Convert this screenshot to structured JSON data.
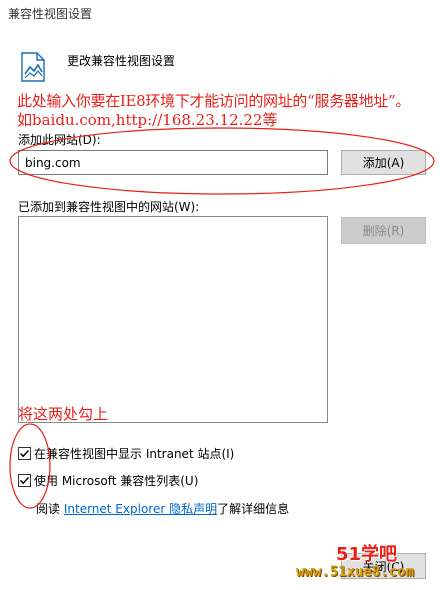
{
  "window": {
    "title": "兼容性视图设置"
  },
  "header": {
    "title": "更改兼容性视图设置",
    "icon": "compatibility-view-icon"
  },
  "annotations": {
    "line1": "此处输入你要在IE8环境下才能访问的网址的“服务器地址”。",
    "line2": "如baidu.com,http://168.23.12.22等",
    "line3": "将这两处勾上"
  },
  "add_section": {
    "label": "添加此网站(D):",
    "input_value": "bing.com",
    "add_button": "添加(A)"
  },
  "list_section": {
    "label": "已添加到兼容性视图中的网站(W):",
    "items": [],
    "remove_button": "删除(R)"
  },
  "options": {
    "intranet": {
      "label": "在兼容性视图中显示 Intranet 站点(I)",
      "checked": true
    },
    "ms_list": {
      "label": "使用 Microsoft 兼容性列表(U)",
      "checked": true
    }
  },
  "info": {
    "prefix": "阅读",
    "link": "Internet Explorer 隐私声明",
    "suffix": "了解详细信息"
  },
  "close_button": "关闭(C)",
  "watermark": {
    "logo": "51学吧",
    "url": "www.51xue8.com"
  },
  "colors": {
    "annotation": "#e8201a",
    "link": "#0066cc",
    "watermark_url": "#d4a017"
  }
}
